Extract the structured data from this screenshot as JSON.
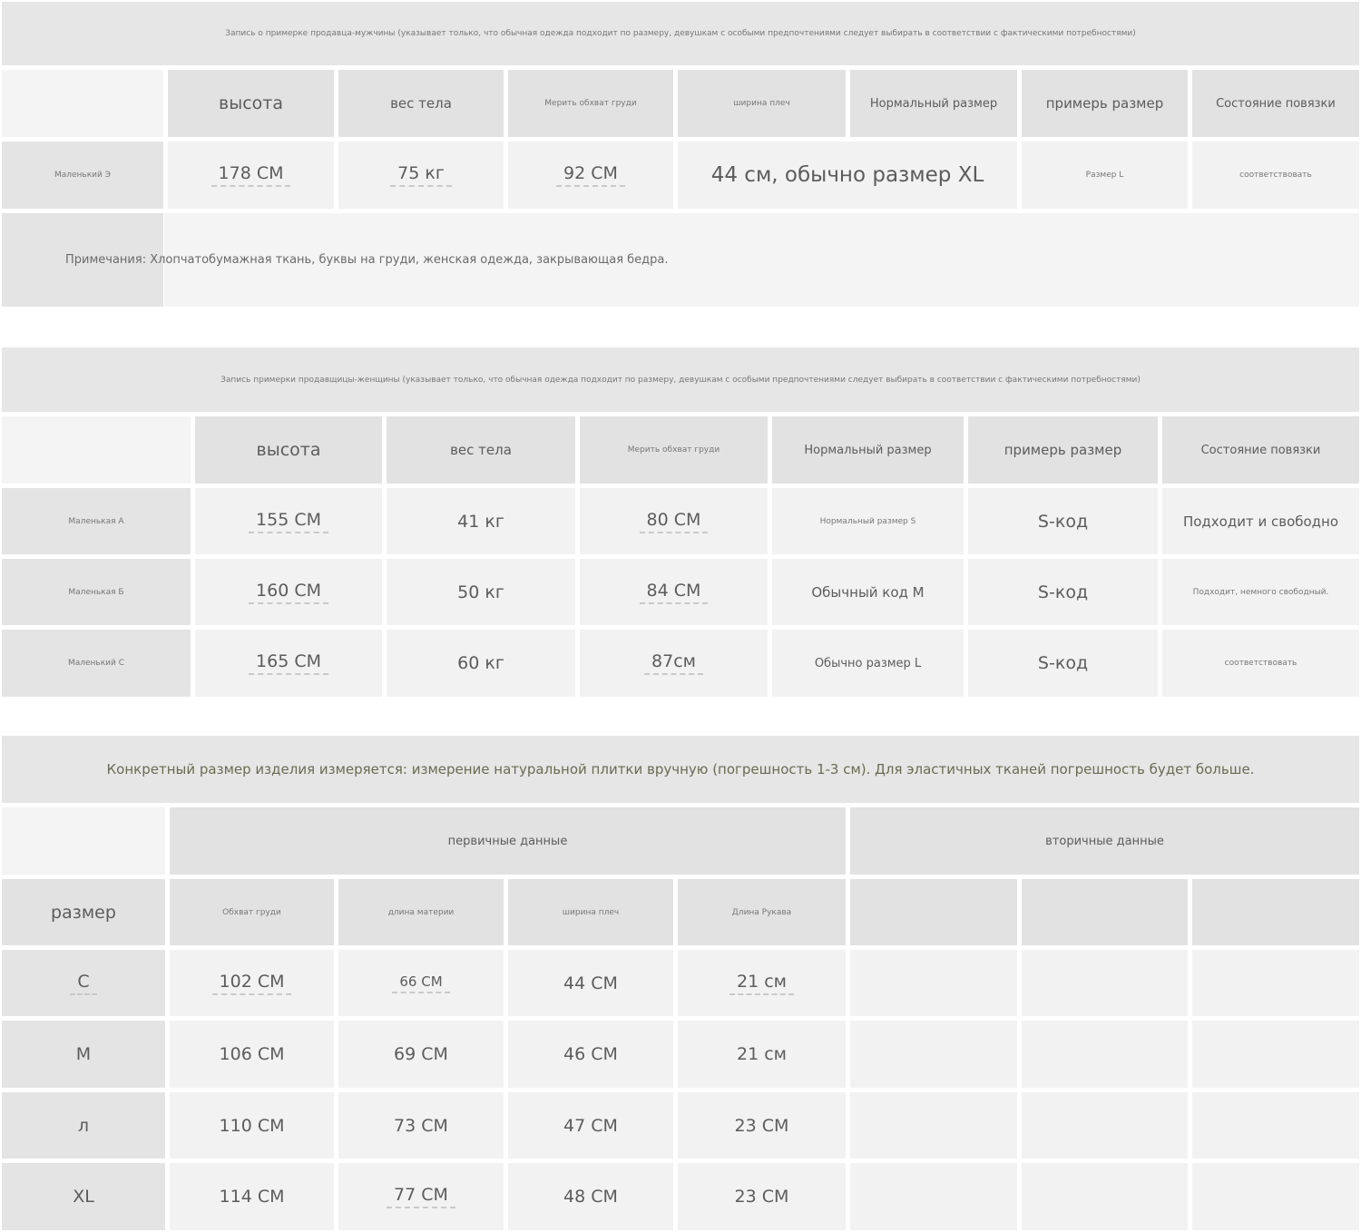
{
  "men": {
    "title": "Запись о примерке продавца-мужчины (указывает только, что обычная одежда подходит по размеру, девушкам с особыми предпочтениями следует выбирать в соответствии с фактическими потребностями)",
    "headers": [
      "высота",
      "вес тела",
      "Мерить обхват груди",
      "ширина плеч",
      "Нормальный размер",
      "примерь размер",
      "Состояние повязки"
    ],
    "row": {
      "name": "Маленький Э",
      "height": "178 СМ",
      "weight": "75 кг",
      "chest": "92 СМ",
      "shoulders_normal": "44 см, обычно размер XL",
      "try_size": "Размер L",
      "fit": "соответствовать"
    },
    "note": "Примечания: Хлопчатобумажная ткань, буквы на груди, женская одежда, закрывающая бедра."
  },
  "women": {
    "title": "Запись примерки продавщицы-женщины (указывает только, что обычная одежда подходит по размеру, девушкам с особыми предпочтениями следует выбирать в соответствии с фактическими потребностями)",
    "headers": [
      "высота",
      "вес тела",
      "Мерить обхват груди",
      "Нормальный размер",
      "примерь размер",
      "Состояние повязки"
    ],
    "rows": [
      {
        "name": "Маленькая А",
        "height": "155 СМ",
        "weight": "41 кг",
        "chest": "80 СМ",
        "normal": "Нормальный размер S",
        "try": "S-код",
        "fit": "Подходит и свободно"
      },
      {
        "name": "Маленькая Б",
        "height": "160 СМ",
        "weight": "50 кг",
        "chest": "84 СМ",
        "normal": "Обычный код М",
        "try": "S-код",
        "fit": "Подходит, немного свободный."
      },
      {
        "name": "Маленький С",
        "height": "165 СМ",
        "weight": "60 кг",
        "chest": "87см",
        "normal": "Обычно размер L",
        "try": "S-код",
        "fit": "соответствовать"
      }
    ]
  },
  "sizes": {
    "title": "Конкретный размер изделия измеряется: измерение натуральной плитки вручную (погрешность 1-3 см). Для эластичных тканей погрешность будет больше.",
    "group_primary": "первичные данные",
    "group_secondary": "вторичные данные",
    "size_label": "размер",
    "headers": [
      "Обхват груди",
      "длина материи",
      "ширина плеч",
      "Длина Рукава"
    ],
    "rows": [
      {
        "size": "С",
        "chest": "102 СМ",
        "length": "66 СМ",
        "shoulders": "44 СМ",
        "sleeve": "21 см"
      },
      {
        "size": "М",
        "chest": "106 СМ",
        "length": "69 СМ",
        "shoulders": "46 СМ",
        "sleeve": "21 см"
      },
      {
        "size": "л",
        "chest": "110 СМ",
        "length": "73 СМ",
        "shoulders": "47 СМ",
        "sleeve": "23 СМ"
      },
      {
        "size": "XL",
        "chest": "114 СМ",
        "length": "77 СМ",
        "shoulders": "48 СМ",
        "sleeve": "23 СМ"
      }
    ]
  }
}
